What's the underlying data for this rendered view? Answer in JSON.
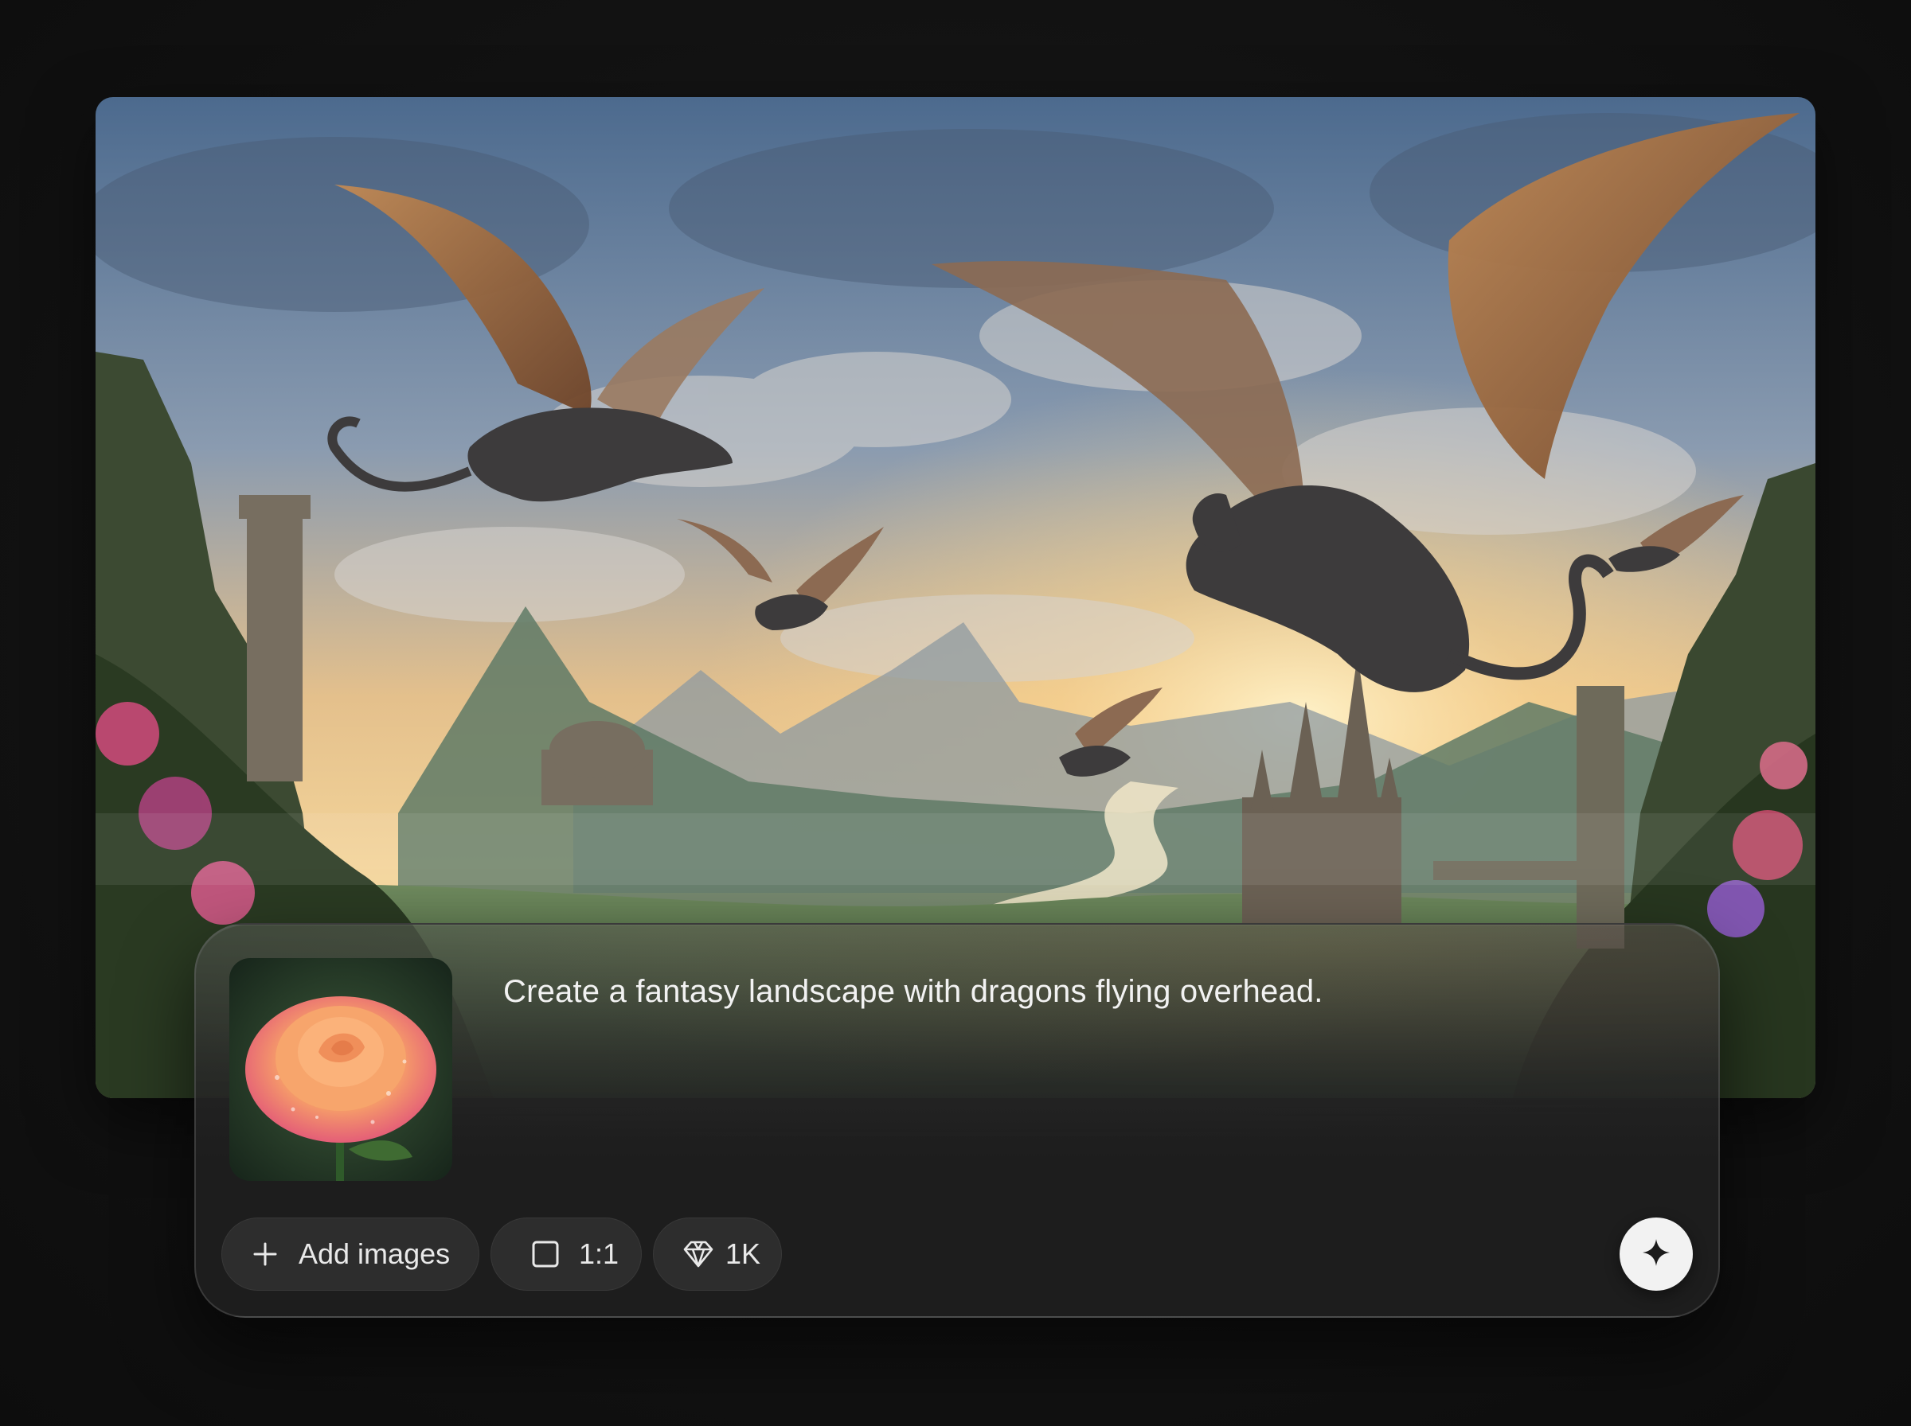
{
  "prompt": {
    "text": "Create a fantasy landscape with dragons flying overhead."
  },
  "toolbar": {
    "add_images_label": "Add images",
    "aspect_ratio_label": "1:1",
    "quality_label": "1K"
  },
  "icons": {
    "add": "plus-icon",
    "aspect_ratio": "square-icon",
    "quality": "diamond-icon",
    "send": "sparkle-icon"
  },
  "colors": {
    "background": "#111111",
    "composer": "#1d1d1d",
    "chip": "#2b2b2b",
    "send_button": "#f2f2f2",
    "text": "#f2f2f2"
  }
}
